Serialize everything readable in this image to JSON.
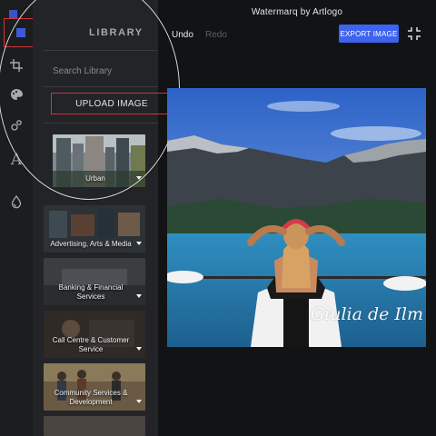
{
  "app": {
    "title": "Watermarq by Artlogo"
  },
  "toolbar": {
    "undo": "Undo",
    "redo": "Redo",
    "export": "EXPORT IMAGE"
  },
  "library": {
    "title": "LIBRARY",
    "search_placeholder": "Search Library",
    "upload": "UPLOAD IMAGE",
    "categories": [
      {
        "label": "Urban"
      },
      {
        "label": "Advertising, Arts & Media"
      },
      {
        "label": "Banking & Financial Services"
      },
      {
        "label": "Call Centre & Customer Service"
      },
      {
        "label": "Community Services & Development"
      }
    ]
  },
  "rail": {
    "icons": [
      "layers-icon",
      "crop-icon",
      "palette-icon",
      "bubbles-icon",
      "text-icon",
      "droplet-icon"
    ]
  },
  "watermark": {
    "text": "Giulia de Ilm"
  },
  "colors": {
    "accent": "#3d63f0",
    "highlight": "#d3323c",
    "panel": "#232427",
    "rail": "#1c1d1f",
    "background": "#121314"
  }
}
